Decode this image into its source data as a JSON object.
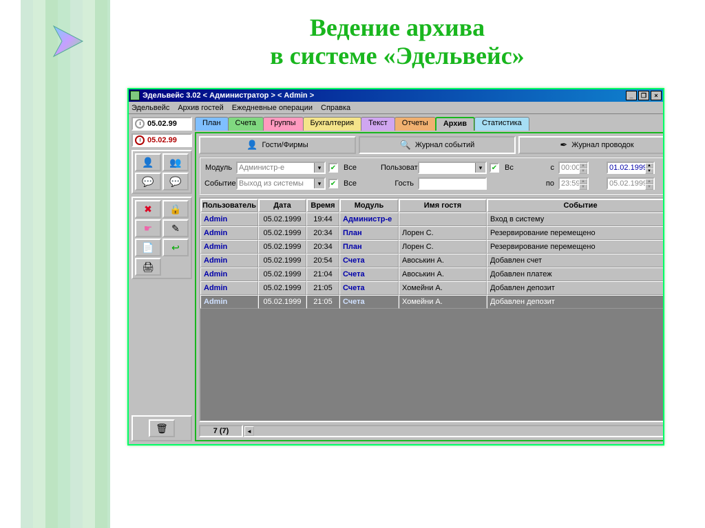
{
  "slide": {
    "title_line1": "Ведение архива",
    "title_line2": "в системе «Эдельвейс»"
  },
  "window": {
    "title": "Эдельвейс 3.02 < Администратор > < Admin >"
  },
  "menu": [
    "Эдельвейс",
    "Архив гостей",
    "Ежедневные операции",
    "Справка"
  ],
  "dates": {
    "top": "05.02.99",
    "bottom": "05.02.99"
  },
  "tabs": [
    "План",
    "Счета",
    "Группы",
    "Бухгалтерия",
    "Текст",
    "Отчеты",
    "Архив",
    "Статистика"
  ],
  "subtabs": {
    "guests": "Гости/Фирмы",
    "journal": "Журнал событий",
    "postings": "Журнал проводок"
  },
  "filters": {
    "module_label": "Модуль",
    "module_value": "Администр-е",
    "event_label": "Событие",
    "event_value": "Выход из системы",
    "all": "Все",
    "user_label": "Пользоват",
    "user_value": "",
    "guest_label": "Гость",
    "guest_value": "",
    "vs": "Вс",
    "from_label": "с",
    "to_label": "по",
    "from_time": "00:00",
    "to_time": "23:59",
    "from_date": "01.02.1999",
    "to_date": "05.02.1999"
  },
  "columns": [
    "Пользователь",
    "Дата",
    "Время",
    "Модуль",
    "Имя гостя",
    "Событие"
  ],
  "rows": [
    {
      "user": "Admin",
      "date": "05.02.1999",
      "time": "19:44",
      "module": "Администр-е",
      "guest": "",
      "event": "Вход в систему",
      "sel": false
    },
    {
      "user": "Admin",
      "date": "05.02.1999",
      "time": "20:34",
      "module": "План",
      "guest": "Лорен С.",
      "event": "Резервирование перемещено",
      "sel": false
    },
    {
      "user": "Admin",
      "date": "05.02.1999",
      "time": "20:34",
      "module": "План",
      "guest": "Лорен С.",
      "event": "Резервирование перемещено",
      "sel": false
    },
    {
      "user": "Admin",
      "date": "05.02.1999",
      "time": "20:54",
      "module": "Счета",
      "guest": "Авоськин А.",
      "event": "Добавлен счет",
      "sel": false
    },
    {
      "user": "Admin",
      "date": "05.02.1999",
      "time": "21:04",
      "module": "Счета",
      "guest": "Авоськин А.",
      "event": "Добавлен платеж",
      "sel": false
    },
    {
      "user": "Admin",
      "date": "05.02.1999",
      "time": "21:05",
      "module": "Счета",
      "guest": "Хомейни А.",
      "event": "Добавлен депозит",
      "sel": false
    },
    {
      "user": "Admin",
      "date": "05.02.1999",
      "time": "21:05",
      "module": "Счета",
      "guest": "Хомейни А.",
      "event": "Добавлен депозит",
      "sel": true
    }
  ],
  "status": {
    "count": "7 (7)"
  }
}
